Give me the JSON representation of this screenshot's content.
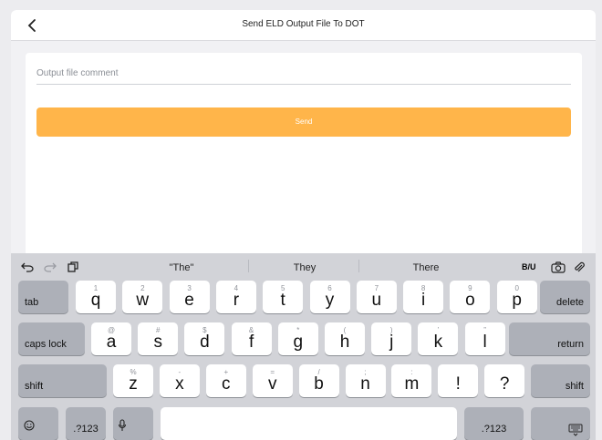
{
  "nav": {
    "title": "Send ELD Output File To DOT",
    "back_icon": "chevron-left-icon"
  },
  "form": {
    "comment_placeholder": "Output file comment",
    "send_label": "Send",
    "send_color": "#ffb54a"
  },
  "keyboard": {
    "suggestions": [
      "\"The\"",
      "They",
      "There"
    ],
    "format_label": "B/U",
    "row1": {
      "fn_left": "tab",
      "fn_right": "delete",
      "keys": [
        {
          "main": "q",
          "sub": "1"
        },
        {
          "main": "w",
          "sub": "2"
        },
        {
          "main": "e",
          "sub": "3"
        },
        {
          "main": "r",
          "sub": "4"
        },
        {
          "main": "t",
          "sub": "5"
        },
        {
          "main": "y",
          "sub": "6"
        },
        {
          "main": "u",
          "sub": "7"
        },
        {
          "main": "i",
          "sub": "8"
        },
        {
          "main": "o",
          "sub": "9"
        },
        {
          "main": "p",
          "sub": "0"
        }
      ]
    },
    "row2": {
      "fn_left": "caps lock",
      "fn_right": "return",
      "keys": [
        {
          "main": "a",
          "sub": "@"
        },
        {
          "main": "s",
          "sub": "#"
        },
        {
          "main": "d",
          "sub": "$"
        },
        {
          "main": "f",
          "sub": "&"
        },
        {
          "main": "g",
          "sub": "*"
        },
        {
          "main": "h",
          "sub": "("
        },
        {
          "main": "j",
          "sub": ")"
        },
        {
          "main": "k",
          "sub": "’"
        },
        {
          "main": "l",
          "sub": "”"
        }
      ]
    },
    "row3": {
      "fn_left": "shift",
      "fn_right": "shift",
      "keys": [
        {
          "main": "z",
          "sub": "%"
        },
        {
          "main": "x",
          "sub": "-"
        },
        {
          "main": "c",
          "sub": "+"
        },
        {
          "main": "v",
          "sub": "="
        },
        {
          "main": "b",
          "sub": "/"
        },
        {
          "main": "n",
          "sub": ";"
        },
        {
          "main": "m",
          "sub": ":"
        },
        {
          "main": "!",
          "sub": ""
        },
        {
          "main": "?",
          "sub": ""
        }
      ]
    },
    "row4": {
      "numbers_left": ".?123",
      "numbers_right": ".?123",
      "space": ""
    }
  }
}
